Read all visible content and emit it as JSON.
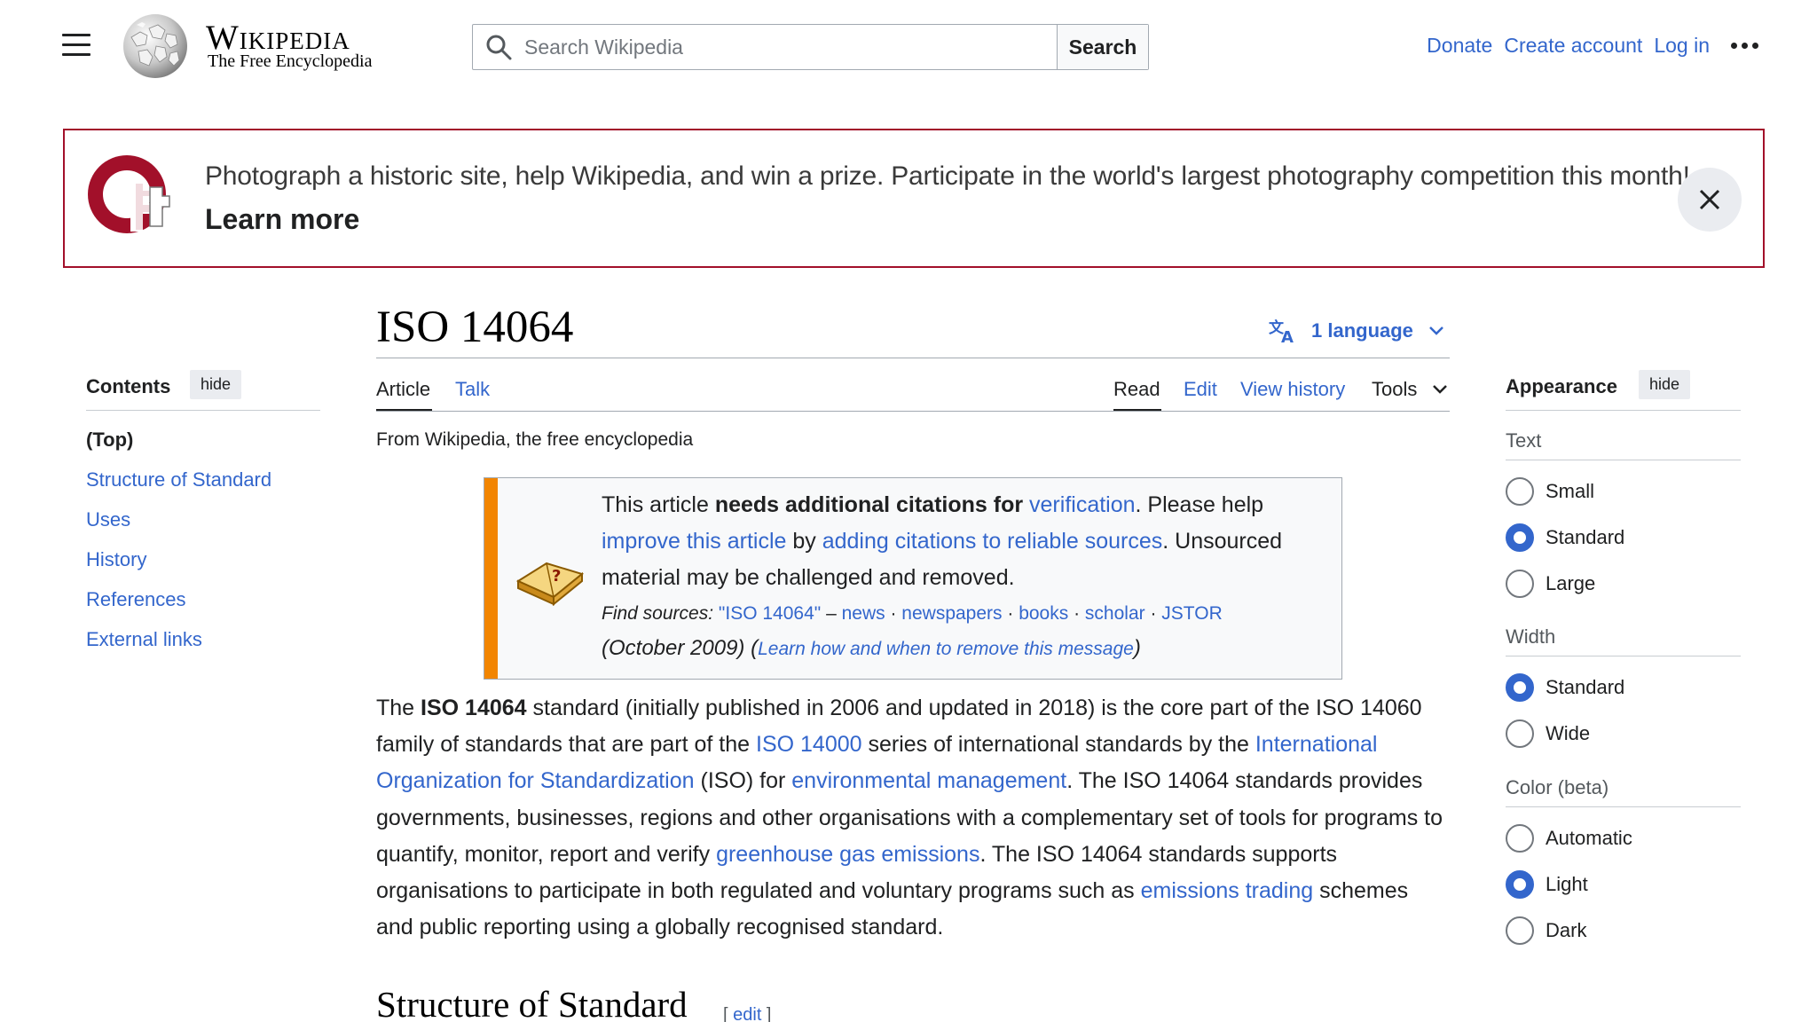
{
  "header": {
    "wordmark": "Wikipedia",
    "tagline": "The Free Encyclopedia",
    "search_placeholder": "Search Wikipedia",
    "search_button": "Search",
    "user_links": [
      "Donate",
      "Create account",
      "Log in"
    ]
  },
  "banner": {
    "text": "Photograph a historic site, help Wikipedia, and win a prize. Participate in the world's largest photography competition this month!",
    "link": "Learn more",
    "border_color": "#a2102a"
  },
  "toc": {
    "title": "Contents",
    "hide": "hide",
    "items": [
      "(Top)",
      "Structure of Standard",
      "Uses",
      "History",
      "References",
      "External links"
    ]
  },
  "article": {
    "title": "ISO 14064",
    "language_button": "1 language",
    "tabs_left": [
      "Article",
      "Talk"
    ],
    "tabs_right": [
      "Read",
      "Edit",
      "View history",
      "Tools"
    ],
    "from": "From Wikipedia, the free encyclopedia",
    "ambox": {
      "t1": "This article ",
      "t2": "needs additional citations for ",
      "t3": "verification",
      "t4": ". Please help ",
      "t5": "improve this article",
      "t6": " by ",
      "t7": "adding citations to reliable sources",
      "t8": ". Unsourced material may be challenged and removed.",
      "find": "Find sources:",
      "query": "\"ISO 14064\"",
      "dash": " – ",
      "sources": [
        "news",
        "newspapers",
        "books",
        "scholar",
        "JSTOR"
      ],
      "date": "(October 2009)",
      "learn": "Learn how and when to remove this message",
      "stripe_color": "#f28500"
    },
    "paragraph": {
      "p1": "The ",
      "p2": "ISO 14064",
      "p3": " standard (initially published in 2006 and updated in 2018) is the core part of the ISO 14060 family of standards that are part of the ",
      "p4": "ISO 14000",
      "p5": " series of international standards by the ",
      "p6": "International Organization for Standardization",
      "p7": " (ISO) for ",
      "p8": "environmental management",
      "p9": ". The ISO 14064 standards provides governments, businesses, regions and other organisations with a complementary set of tools for programs to quantify, monitor, report and verify ",
      "p10": "greenhouse gas emissions",
      "p11": ". The ISO 14064 standards supports organisations to participate in both regulated and voluntary programs such as ",
      "p12": "emissions trading",
      "p13": " schemes and public reporting using a globally recognised standard."
    },
    "section_title": "Structure of Standard",
    "section_edit": "edit"
  },
  "appearance": {
    "title": "Appearance",
    "hide": "hide",
    "text_label": "Text",
    "text_options": [
      "Small",
      "Standard",
      "Large"
    ],
    "text_selected": "Standard",
    "width_label": "Width",
    "width_options": [
      "Standard",
      "Wide"
    ],
    "width_selected": "Standard",
    "color_label": "Color (beta)",
    "color_options": [
      "Automatic",
      "Light",
      "Dark"
    ],
    "color_selected": "Light",
    "accent": "#3366cc"
  }
}
